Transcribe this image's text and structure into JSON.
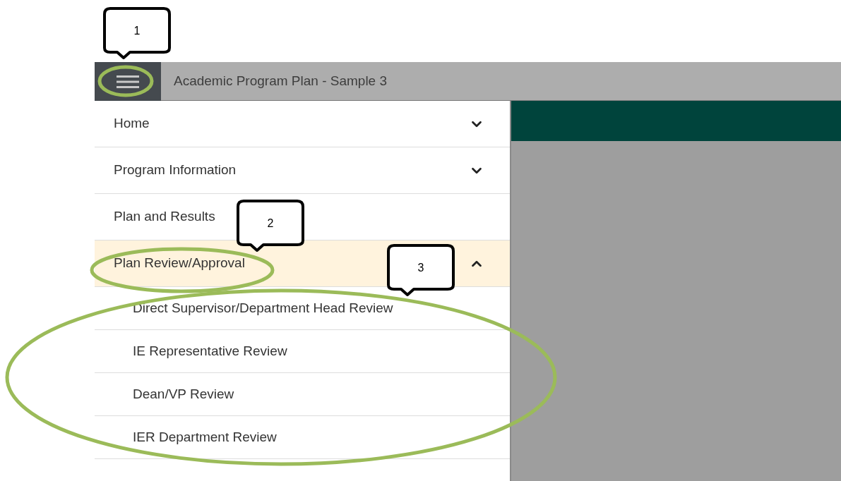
{
  "header": {
    "title": "Academic Program Plan - Sample 3"
  },
  "sidebar": {
    "items": [
      {
        "label": "Home",
        "kind": "group",
        "expanded": false,
        "selected": false
      },
      {
        "label": "Program Information",
        "kind": "group",
        "expanded": false,
        "selected": false
      },
      {
        "label": "Plan and Results",
        "kind": "link",
        "selected": false
      },
      {
        "label": "Plan Review/Approval",
        "kind": "group",
        "expanded": true,
        "selected": true,
        "children": [
          {
            "label": "Direct Supervisor/Department Head Review"
          },
          {
            "label": "IE Representative Review"
          },
          {
            "label": "Dean/VP Review"
          },
          {
            "label": "IER Department Review"
          }
        ]
      }
    ]
  },
  "callouts": [
    {
      "number": "1"
    },
    {
      "number": "2"
    },
    {
      "number": "3"
    }
  ]
}
